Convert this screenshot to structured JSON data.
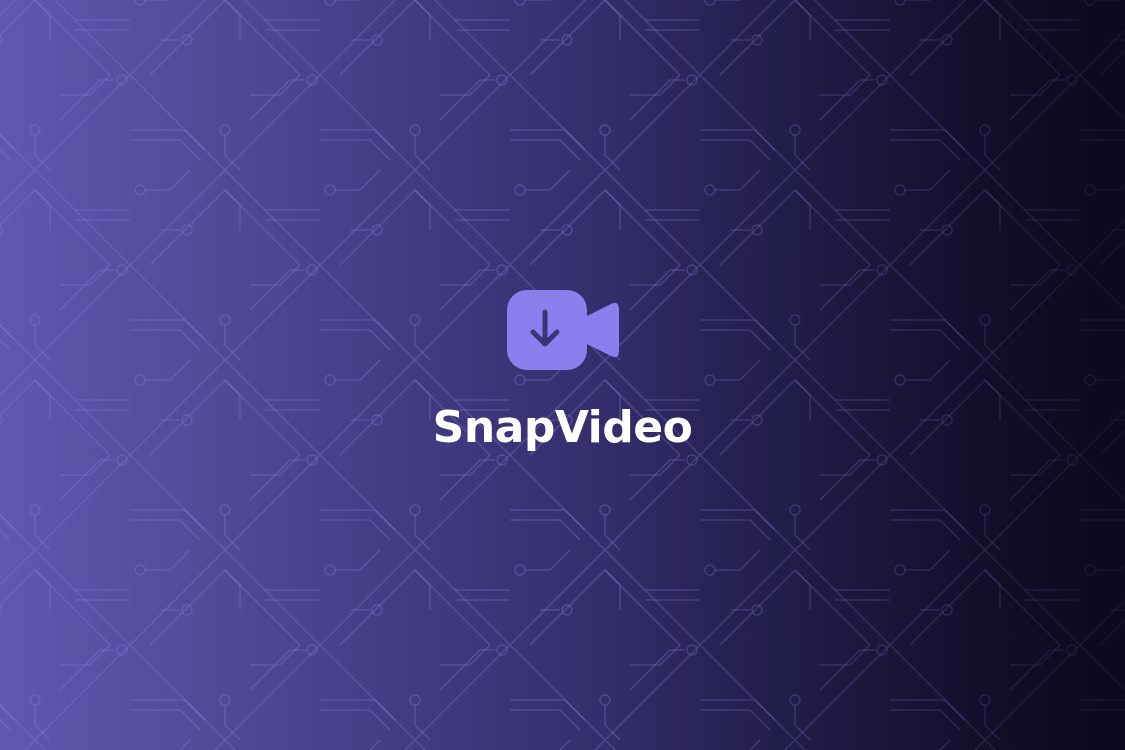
{
  "app": {
    "name": "SnapVideo"
  },
  "logo": {
    "icon": "video-download-icon",
    "accent_color": "#8b7ff0",
    "arrow_color": "#3b3478"
  },
  "background": {
    "gradient_start": "#6058ad",
    "gradient_end": "#0c0a1e",
    "pattern_color": "#8a80e0",
    "pattern": "circuit-lines"
  }
}
